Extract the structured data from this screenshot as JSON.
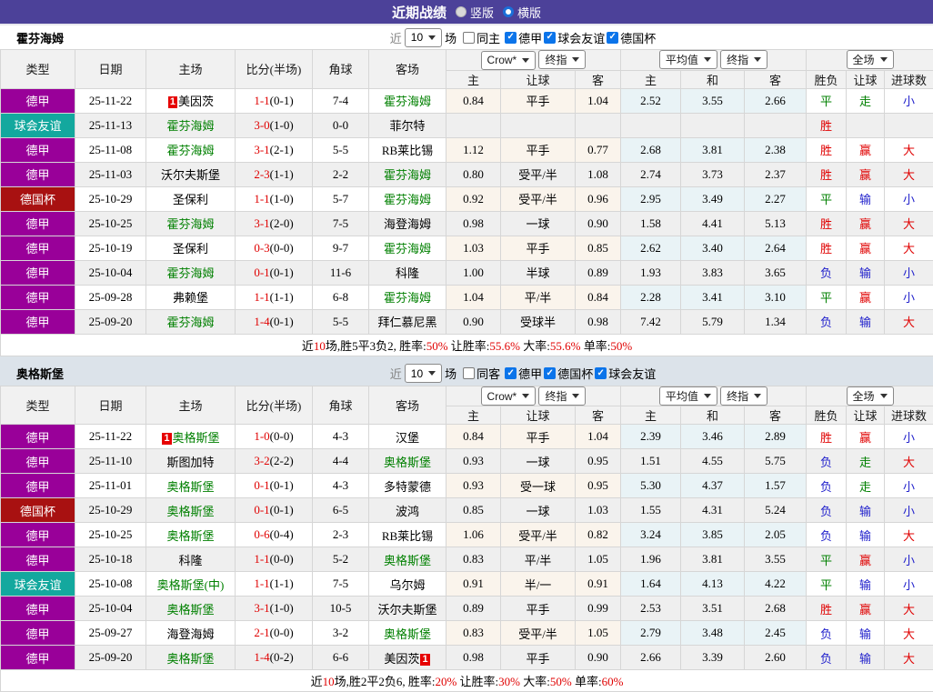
{
  "page": {
    "title": "近期战绩",
    "view_vertical": "竖版",
    "view_horizontal": "横版",
    "selected_view": "横版"
  },
  "theme": {
    "topbar": "#4c4199",
    "badge": "#e60000",
    "score_red": "#e00000",
    "team_green": "#008000",
    "section2_band": "#dce3ea"
  },
  "league_colors": {
    "德甲": "#990099",
    "球会友谊": "#13a89e",
    "德国杯": "#a81111"
  },
  "result_colors": {
    "red": "#e00000",
    "green": "#008000",
    "blue": "#2222cc"
  },
  "table_columns": {
    "type": "类型",
    "date": "日期",
    "home": "主场",
    "score": "比分(半场)",
    "corners": "角球",
    "away": "客场",
    "odds_home": "主",
    "odds_handicap": "让球",
    "odds_away": "客",
    "avg_home": "主",
    "avg_draw": "和",
    "avg_away": "客",
    "result": "胜负",
    "handicap_result": "让球",
    "goals": "进球数"
  },
  "sections": [
    {
      "team": "霍芬海姆",
      "filter": {
        "near_label": "近",
        "count": "10",
        "games_label": "场",
        "same_label": "同主",
        "same_checked": false,
        "leagues": [
          {
            "label": "德甲",
            "checked": true
          },
          {
            "label": "球会友谊",
            "checked": true
          },
          {
            "label": "德国杯",
            "checked": true
          }
        ]
      },
      "selects": {
        "odds_source": "Crow*",
        "odds_mode": "终指",
        "avg_source": "平均值",
        "avg_mode": "终指",
        "scope": "全场"
      },
      "rows": [
        {
          "league": "德甲",
          "date": "25-11-22",
          "home": {
            "text": "美因茨",
            "green": false,
            "badge": "pre"
          },
          "score": "1-1",
          "half": "(0-1)",
          "corners": "7-4",
          "away": {
            "text": "霍芬海姆",
            "green": true
          },
          "crown": [
            "0.84",
            "平手",
            "1.04"
          ],
          "avg": [
            "2.52",
            "3.55",
            "2.66"
          ],
          "results": [
            {
              "t": "平",
              "c": "green"
            },
            {
              "t": "走",
              "c": "green"
            },
            {
              "t": "小",
              "c": "blue"
            }
          ]
        },
        {
          "league": "球会友谊",
          "date": "25-11-13",
          "home": {
            "text": "霍芬海姆",
            "green": true
          },
          "score": "3-0",
          "half": "(1-0)",
          "corners": "0-0",
          "away": {
            "text": "菲尔特",
            "green": false
          },
          "crown": [
            "",
            "",
            ""
          ],
          "avg": [
            "",
            "",
            ""
          ],
          "results": [
            {
              "t": "胜",
              "c": "red"
            },
            {
              "t": ""
            },
            {
              "t": ""
            }
          ]
        },
        {
          "league": "德甲",
          "date": "25-11-08",
          "home": {
            "text": "霍芬海姆",
            "green": true
          },
          "score": "3-1",
          "half": "(2-1)",
          "corners": "5-5",
          "away": {
            "text": "RB莱比锡",
            "green": false
          },
          "crown": [
            "1.12",
            "平手",
            "0.77"
          ],
          "avg": [
            "2.68",
            "3.81",
            "2.38"
          ],
          "results": [
            {
              "t": "胜",
              "c": "red"
            },
            {
              "t": "赢",
              "c": "red"
            },
            {
              "t": "大",
              "c": "red"
            }
          ]
        },
        {
          "league": "德甲",
          "date": "25-11-03",
          "home": {
            "text": "沃尔夫斯堡",
            "green": false
          },
          "score": "2-3",
          "half": "(1-1)",
          "corners": "2-2",
          "away": {
            "text": "霍芬海姆",
            "green": true
          },
          "crown": [
            "0.80",
            "受平/半",
            "1.08"
          ],
          "avg": [
            "2.74",
            "3.73",
            "2.37"
          ],
          "results": [
            {
              "t": "胜",
              "c": "red"
            },
            {
              "t": "赢",
              "c": "red"
            },
            {
              "t": "大",
              "c": "red"
            }
          ]
        },
        {
          "league": "德国杯",
          "date": "25-10-29",
          "home": {
            "text": "圣保利",
            "green": false
          },
          "score": "1-1",
          "half": "(1-0)",
          "corners": "5-7",
          "away": {
            "text": "霍芬海姆",
            "green": true
          },
          "crown": [
            "0.92",
            "受平/半",
            "0.96"
          ],
          "avg": [
            "2.95",
            "3.49",
            "2.27"
          ],
          "results": [
            {
              "t": "平",
              "c": "green"
            },
            {
              "t": "输",
              "c": "blue"
            },
            {
              "t": "小",
              "c": "blue"
            }
          ]
        },
        {
          "league": "德甲",
          "date": "25-10-25",
          "home": {
            "text": "霍芬海姆",
            "green": true
          },
          "score": "3-1",
          "half": "(2-0)",
          "corners": "7-5",
          "away": {
            "text": "海登海姆",
            "green": false
          },
          "crown": [
            "0.98",
            "一球",
            "0.90"
          ],
          "avg": [
            "1.58",
            "4.41",
            "5.13"
          ],
          "results": [
            {
              "t": "胜",
              "c": "red"
            },
            {
              "t": "赢",
              "c": "red"
            },
            {
              "t": "大",
              "c": "red"
            }
          ]
        },
        {
          "league": "德甲",
          "date": "25-10-19",
          "home": {
            "text": "圣保利",
            "green": false
          },
          "score": "0-3",
          "half": "(0-0)",
          "corners": "9-7",
          "away": {
            "text": "霍芬海姆",
            "green": true
          },
          "crown": [
            "1.03",
            "平手",
            "0.85"
          ],
          "avg": [
            "2.62",
            "3.40",
            "2.64"
          ],
          "results": [
            {
              "t": "胜",
              "c": "red"
            },
            {
              "t": "赢",
              "c": "red"
            },
            {
              "t": "大",
              "c": "red"
            }
          ]
        },
        {
          "league": "德甲",
          "date": "25-10-04",
          "home": {
            "text": "霍芬海姆",
            "green": true
          },
          "score": "0-1",
          "half": "(0-1)",
          "corners": "11-6",
          "away": {
            "text": "科隆",
            "green": false
          },
          "crown": [
            "1.00",
            "半球",
            "0.89"
          ],
          "avg": [
            "1.93",
            "3.83",
            "3.65"
          ],
          "results": [
            {
              "t": "负",
              "c": "blue"
            },
            {
              "t": "输",
              "c": "blue"
            },
            {
              "t": "小",
              "c": "blue"
            }
          ]
        },
        {
          "league": "德甲",
          "date": "25-09-28",
          "home": {
            "text": "弗赖堡",
            "green": false
          },
          "score": "1-1",
          "half": "(1-1)",
          "corners": "6-8",
          "away": {
            "text": "霍芬海姆",
            "green": true
          },
          "crown": [
            "1.04",
            "平/半",
            "0.84"
          ],
          "avg": [
            "2.28",
            "3.41",
            "3.10"
          ],
          "results": [
            {
              "t": "平",
              "c": "green"
            },
            {
              "t": "赢",
              "c": "red"
            },
            {
              "t": "小",
              "c": "blue"
            }
          ]
        },
        {
          "league": "德甲",
          "date": "25-09-20",
          "home": {
            "text": "霍芬海姆",
            "green": true
          },
          "score": "1-4",
          "half": "(0-1)",
          "corners": "5-5",
          "away": {
            "text": "拜仁慕尼黑",
            "green": false
          },
          "crown": [
            "0.90",
            "受球半",
            "0.98"
          ],
          "avg": [
            "7.42",
            "5.79",
            "1.34"
          ],
          "results": [
            {
              "t": "负",
              "c": "blue"
            },
            {
              "t": "输",
              "c": "blue"
            },
            {
              "t": "大",
              "c": "red"
            }
          ]
        }
      ],
      "summary": [
        {
          "t": "近"
        },
        {
          "t": "10",
          "red": true
        },
        {
          "t": "场,胜5平3负2, 胜率:"
        },
        {
          "t": "50%",
          "red": true
        },
        {
          "t": " 让胜率:"
        },
        {
          "t": "55.6%",
          "red": true
        },
        {
          "t": " 大率:"
        },
        {
          "t": "55.6%",
          "red": true
        },
        {
          "t": " 单率:"
        },
        {
          "t": "50%",
          "red": true
        }
      ]
    },
    {
      "team": "奥格斯堡",
      "filter": {
        "near_label": "近",
        "count": "10",
        "games_label": "场",
        "same_label": "同客",
        "same_checked": false,
        "leagues": [
          {
            "label": "德甲",
            "checked": true
          },
          {
            "label": "德国杯",
            "checked": true
          },
          {
            "label": "球会友谊",
            "checked": true
          }
        ]
      },
      "selects": {
        "odds_source": "Crow*",
        "odds_mode": "终指",
        "avg_source": "平均值",
        "avg_mode": "终指",
        "scope": "全场"
      },
      "rows": [
        {
          "league": "德甲",
          "date": "25-11-22",
          "home": {
            "text": "奥格斯堡",
            "green": true,
            "badge": "pre"
          },
          "score": "1-0",
          "half": "(0-0)",
          "corners": "4-3",
          "away": {
            "text": "汉堡",
            "green": false
          },
          "crown": [
            "0.84",
            "平手",
            "1.04"
          ],
          "avg": [
            "2.39",
            "3.46",
            "2.89"
          ],
          "results": [
            {
              "t": "胜",
              "c": "red"
            },
            {
              "t": "赢",
              "c": "red"
            },
            {
              "t": "小",
              "c": "blue"
            }
          ]
        },
        {
          "league": "德甲",
          "date": "25-11-10",
          "home": {
            "text": "斯图加特",
            "green": false
          },
          "score": "3-2",
          "half": "(2-2)",
          "corners": "4-4",
          "away": {
            "text": "奥格斯堡",
            "green": true
          },
          "crown": [
            "0.93",
            "一球",
            "0.95"
          ],
          "avg": [
            "1.51",
            "4.55",
            "5.75"
          ],
          "results": [
            {
              "t": "负",
              "c": "blue"
            },
            {
              "t": "走",
              "c": "green"
            },
            {
              "t": "大",
              "c": "red"
            }
          ]
        },
        {
          "league": "德甲",
          "date": "25-11-01",
          "home": {
            "text": "奥格斯堡",
            "green": true
          },
          "score": "0-1",
          "half": "(0-1)",
          "corners": "4-3",
          "away": {
            "text": "多特蒙德",
            "green": false
          },
          "crown": [
            "0.93",
            "受一球",
            "0.95"
          ],
          "avg": [
            "5.30",
            "4.37",
            "1.57"
          ],
          "results": [
            {
              "t": "负",
              "c": "blue"
            },
            {
              "t": "走",
              "c": "green"
            },
            {
              "t": "小",
              "c": "blue"
            }
          ]
        },
        {
          "league": "德国杯",
          "date": "25-10-29",
          "home": {
            "text": "奥格斯堡",
            "green": true
          },
          "score": "0-1",
          "half": "(0-1)",
          "corners": "6-5",
          "away": {
            "text": "波鸿",
            "green": false
          },
          "crown": [
            "0.85",
            "一球",
            "1.03"
          ],
          "avg": [
            "1.55",
            "4.31",
            "5.24"
          ],
          "results": [
            {
              "t": "负",
              "c": "blue"
            },
            {
              "t": "输",
              "c": "blue"
            },
            {
              "t": "小",
              "c": "blue"
            }
          ]
        },
        {
          "league": "德甲",
          "date": "25-10-25",
          "home": {
            "text": "奥格斯堡",
            "green": true
          },
          "score": "0-6",
          "half": "(0-4)",
          "corners": "2-3",
          "away": {
            "text": "RB莱比锡",
            "green": false
          },
          "crown": [
            "1.06",
            "受平/半",
            "0.82"
          ],
          "avg": [
            "3.24",
            "3.85",
            "2.05"
          ],
          "results": [
            {
              "t": "负",
              "c": "blue"
            },
            {
              "t": "输",
              "c": "blue"
            },
            {
              "t": "大",
              "c": "red"
            }
          ]
        },
        {
          "league": "德甲",
          "date": "25-10-18",
          "home": {
            "text": "科隆",
            "green": false
          },
          "score": "1-1",
          "half": "(0-0)",
          "corners": "5-2",
          "away": {
            "text": "奥格斯堡",
            "green": true
          },
          "crown": [
            "0.83",
            "平/半",
            "1.05"
          ],
          "avg": [
            "1.96",
            "3.81",
            "3.55"
          ],
          "results": [
            {
              "t": "平",
              "c": "green"
            },
            {
              "t": "赢",
              "c": "red"
            },
            {
              "t": "小",
              "c": "blue"
            }
          ]
        },
        {
          "league": "球会友谊",
          "date": "25-10-08",
          "home": {
            "text": "奥格斯堡(中)",
            "green": true
          },
          "score": "1-1",
          "half": "(1-1)",
          "corners": "7-5",
          "away": {
            "text": "乌尔姆",
            "green": false
          },
          "crown": [
            "0.91",
            "半/一",
            "0.91"
          ],
          "avg": [
            "1.64",
            "4.13",
            "4.22"
          ],
          "results": [
            {
              "t": "平",
              "c": "green"
            },
            {
              "t": "输",
              "c": "blue"
            },
            {
              "t": "小",
              "c": "blue"
            }
          ]
        },
        {
          "league": "德甲",
          "date": "25-10-04",
          "home": {
            "text": "奥格斯堡",
            "green": true
          },
          "score": "3-1",
          "half": "(1-0)",
          "corners": "10-5",
          "away": {
            "text": "沃尔夫斯堡",
            "green": false
          },
          "crown": [
            "0.89",
            "平手",
            "0.99"
          ],
          "avg": [
            "2.53",
            "3.51",
            "2.68"
          ],
          "results": [
            {
              "t": "胜",
              "c": "red"
            },
            {
              "t": "赢",
              "c": "red"
            },
            {
              "t": "大",
              "c": "red"
            }
          ]
        },
        {
          "league": "德甲",
          "date": "25-09-27",
          "home": {
            "text": "海登海姆",
            "green": false
          },
          "score": "2-1",
          "half": "(0-0)",
          "corners": "3-2",
          "away": {
            "text": "奥格斯堡",
            "green": true
          },
          "crown": [
            "0.83",
            "受平/半",
            "1.05"
          ],
          "avg": [
            "2.79",
            "3.48",
            "2.45"
          ],
          "results": [
            {
              "t": "负",
              "c": "blue"
            },
            {
              "t": "输",
              "c": "blue"
            },
            {
              "t": "大",
              "c": "red"
            }
          ]
        },
        {
          "league": "德甲",
          "date": "25-09-20",
          "home": {
            "text": "奥格斯堡",
            "green": true
          },
          "score": "1-4",
          "half": "(0-2)",
          "corners": "6-6",
          "away": {
            "text": "美因茨",
            "green": false,
            "badge": "post"
          },
          "crown": [
            "0.98",
            "平手",
            "0.90"
          ],
          "avg": [
            "2.66",
            "3.39",
            "2.60"
          ],
          "results": [
            {
              "t": "负",
              "c": "blue"
            },
            {
              "t": "输",
              "c": "blue"
            },
            {
              "t": "大",
              "c": "red"
            }
          ]
        }
      ],
      "summary": [
        {
          "t": "近"
        },
        {
          "t": "10",
          "red": true
        },
        {
          "t": "场,胜2平2负6, 胜率:"
        },
        {
          "t": "20%",
          "red": true
        },
        {
          "t": " 让胜率:"
        },
        {
          "t": "30%",
          "red": true
        },
        {
          "t": " 大率:"
        },
        {
          "t": "50%",
          "red": true
        },
        {
          "t": " 单率:"
        },
        {
          "t": "60%",
          "red": true
        }
      ]
    }
  ]
}
